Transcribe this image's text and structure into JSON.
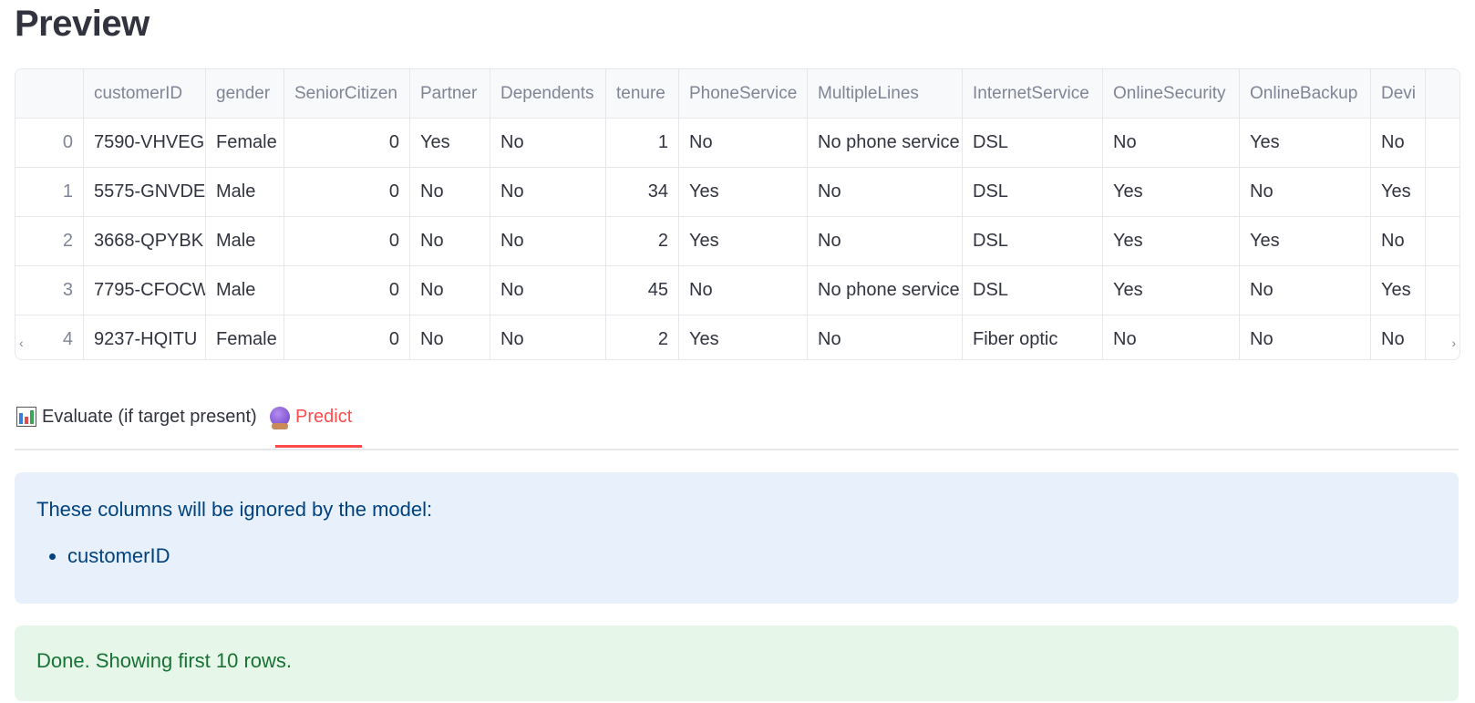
{
  "page": {
    "title": "Preview"
  },
  "table": {
    "columns": [
      "",
      "customerID",
      "gender",
      "SeniorCitizen",
      "Partner",
      "Dependents",
      "tenure",
      "PhoneService",
      "MultipleLines",
      "InternetService",
      "OnlineSecurity",
      "OnlineBackup",
      "Devi"
    ],
    "rows": [
      [
        "0",
        "7590-VHVEG",
        "Female",
        "0",
        "Yes",
        "No",
        "1",
        "No",
        "No phone service",
        "DSL",
        "No",
        "Yes",
        "No"
      ],
      [
        "1",
        "5575-GNVDE",
        "Male",
        "0",
        "No",
        "No",
        "34",
        "Yes",
        "No",
        "DSL",
        "Yes",
        "No",
        "Yes"
      ],
      [
        "2",
        "3668-QPYBK",
        "Male",
        "0",
        "No",
        "No",
        "2",
        "Yes",
        "No",
        "DSL",
        "Yes",
        "Yes",
        "No"
      ],
      [
        "3",
        "7795-CFOCW",
        "Male",
        "0",
        "No",
        "No",
        "45",
        "No",
        "No phone service",
        "DSL",
        "Yes",
        "No",
        "Yes"
      ],
      [
        "4",
        "9237-HQITU",
        "Female",
        "0",
        "No",
        "No",
        "2",
        "Yes",
        "No",
        "Fiber optic",
        "No",
        "No",
        "No"
      ]
    ],
    "scroll_left": "‹",
    "scroll_right": "›"
  },
  "tabs": [
    {
      "label": "Evaluate (if target present)",
      "icon": "bar-chart-icon",
      "active": false
    },
    {
      "label": "Predict",
      "icon": "crystal-ball-icon",
      "active": true
    }
  ],
  "info_alert": {
    "message": "These columns will be ignored by the model:",
    "items": [
      "customerID"
    ]
  },
  "success_alert": {
    "message": "Done. Showing first 10 rows."
  },
  "colors": {
    "accent": "#ff4b4b",
    "info_bg": "#e8f1fb",
    "info_text": "#004280",
    "success_bg": "#e6f7ea",
    "success_text": "#177233"
  }
}
